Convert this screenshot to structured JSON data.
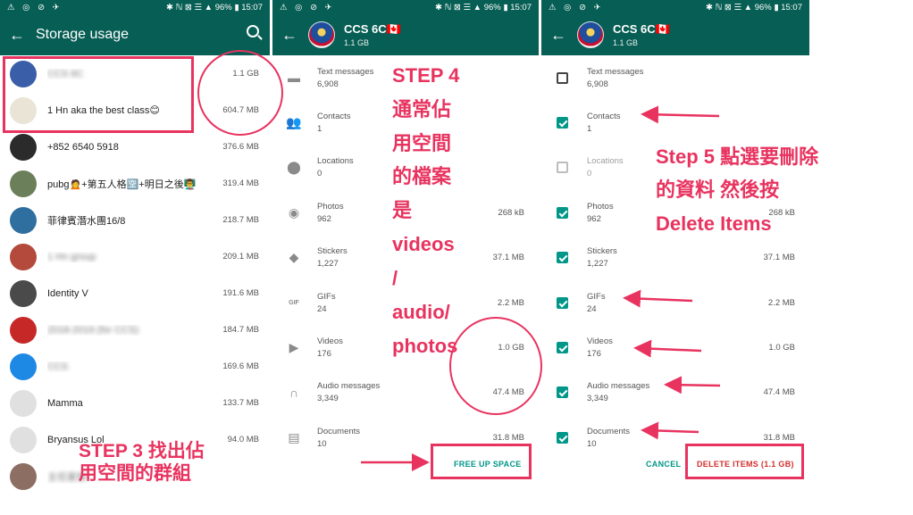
{
  "status": {
    "left_icons": "⚠ ◎ ⊘ ✈",
    "right": "✱ ℕ ⊠ ☰ ▲ 96% ▮ 15:07"
  },
  "screen1": {
    "title": "Storage usage",
    "rows": [
      {
        "name": "CCS 6C",
        "size": "1.1 GB",
        "blurred": true,
        "avatar": "#3a5ea8"
      },
      {
        "name": "1 Hn aka the best class😊",
        "size": "604.7 MB",
        "blurred": false,
        "avatar": "#e9e4d6"
      },
      {
        "name": "+852 6540 5918",
        "size": "376.6 MB",
        "blurred": false,
        "avatar": "#2b2b2b"
      },
      {
        "name": "pubg🙍+第五人格🈳+明日之後👨‍🏫",
        "size": "319.4 MB",
        "blurred": false,
        "avatar": "#6a7f5a"
      },
      {
        "name": "菲律賓潛水團16/8",
        "size": "218.7 MB",
        "blurred": false,
        "avatar": "#2f6f9f"
      },
      {
        "name": "1 Hn group",
        "size": "209.1 MB",
        "blurred": true,
        "avatar": "#b34a3c"
      },
      {
        "name": "Identity V",
        "size": "191.6 MB",
        "blurred": false,
        "avatar": "#4a4a4a"
      },
      {
        "name": "2018-2019 (for CCS)",
        "size": "184.7 MB",
        "blurred": true,
        "avatar": "#c62828"
      },
      {
        "name": "CCS",
        "size": "169.6 MB",
        "blurred": true,
        "avatar": "#1e88e5"
      },
      {
        "name": "Mamma",
        "size": "133.7 MB",
        "blurred": false,
        "avatar": "#e0e0e0"
      },
      {
        "name": "Bryansus Lol",
        "size": "94.0 MB",
        "blurred": false,
        "avatar": "#e0e0e0"
      },
      {
        "name": "主任家族",
        "size": "",
        "blurred": true,
        "avatar": "#8d6e63"
      }
    ]
  },
  "screen2": {
    "group_name": "CCS 6C🇨🇦",
    "group_size": "1.1 GB",
    "rows": [
      {
        "label": "Text messages",
        "count": "6,908",
        "size": "",
        "icon": "message-icon"
      },
      {
        "label": "Contacts",
        "count": "1",
        "size": "",
        "icon": "contacts-icon"
      },
      {
        "label": "Locations",
        "count": "0",
        "size": "",
        "icon": "location-icon"
      },
      {
        "label": "Photos",
        "count": "962",
        "size": "268 kB",
        "icon": "camera-icon"
      },
      {
        "label": "Stickers",
        "count": "1,227",
        "size": "37.1 MB",
        "icon": "sticker-icon"
      },
      {
        "label": "GIFs",
        "count": "24",
        "size": "2.2 MB",
        "icon": "gif-icon"
      },
      {
        "label": "Videos",
        "count": "176",
        "size": "1.0 GB",
        "icon": "video-icon"
      },
      {
        "label": "Audio messages",
        "count": "3,349",
        "size": "47.4 MB",
        "icon": "headphones-icon"
      },
      {
        "label": "Documents",
        "count": "10",
        "size": "31.8 MB",
        "icon": "document-icon"
      }
    ],
    "free_button": "FREE UP SPACE"
  },
  "screen3": {
    "group_name": "CCS 6C🇨🇦",
    "group_size": "1.1 GB",
    "rows": [
      {
        "label": "Text messages",
        "count": "6,908",
        "size": "",
        "state": "off"
      },
      {
        "label": "Contacts",
        "count": "1",
        "size": "",
        "state": "on"
      },
      {
        "label": "Locations",
        "count": "0",
        "size": "",
        "state": "disabled"
      },
      {
        "label": "Photos",
        "count": "962",
        "size": "268 kB",
        "state": "on"
      },
      {
        "label": "Stickers",
        "count": "1,227",
        "size": "37.1 MB",
        "state": "on"
      },
      {
        "label": "GIFs",
        "count": "24",
        "size": "2.2 MB",
        "state": "on"
      },
      {
        "label": "Videos",
        "count": "176",
        "size": "1.0 GB",
        "state": "on"
      },
      {
        "label": "Audio messages",
        "count": "3,349",
        "size": "47.4 MB",
        "state": "on"
      },
      {
        "label": "Documents",
        "count": "10",
        "size": "31.8 MB",
        "state": "on"
      }
    ],
    "cancel_button": "CANCEL",
    "delete_button": "DELETE ITEMS (1.1 GB)"
  },
  "annotations": {
    "step3": [
      "STEP 3 找出佔",
      "用空間的群組"
    ],
    "step4": [
      "STEP 4",
      "通常佔",
      "用空間",
      "的檔案",
      "是",
      "videos",
      "/",
      "audio/",
      "photos"
    ],
    "step5": [
      "Step 5 點選要刪除",
      "的資料 然後按",
      "Delete Items"
    ],
    "accent_color": "#e8335f"
  }
}
